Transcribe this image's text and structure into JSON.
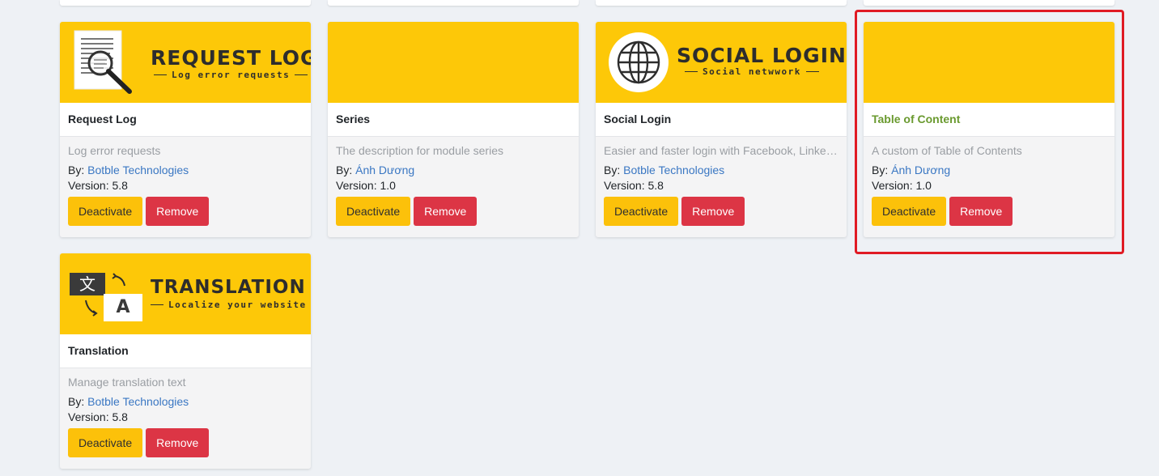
{
  "plugins": [
    {
      "banner": {
        "title": "REQUEST LOG",
        "subtitle": "Log error requests",
        "icon": "document-magnifier-icon"
      },
      "name": "Request Log",
      "description": "Log error requests",
      "by_label": "By:",
      "author": "Botble Technologies",
      "version": "Version: 5.8",
      "deactivate_label": "Deactivate",
      "remove_label": "Remove"
    },
    {
      "banner": {
        "title": "",
        "subtitle": ""
      },
      "name": "Series",
      "description": "The description for module series",
      "by_label": "By:",
      "author": "Ánh Dương",
      "version": "Version: 1.0",
      "deactivate_label": "Deactivate",
      "remove_label": "Remove"
    },
    {
      "banner": {
        "title": "SOCIAL LOGIN",
        "subtitle": "Social netwwork",
        "icon": "globe-icon"
      },
      "name": "Social Login",
      "description": "Easier and faster login with Facebook, LinkedIn, Google, Github",
      "by_label": "By:",
      "author": "Botble Technologies",
      "version": "Version: 5.8",
      "deactivate_label": "Deactivate",
      "remove_label": "Remove"
    },
    {
      "banner": {
        "title": "",
        "subtitle": ""
      },
      "name": "Table of Content",
      "description": "A custom of Table of Contents",
      "by_label": "By:",
      "author": "Ánh Dương",
      "version": "Version: 1.0",
      "deactivate_label": "Deactivate",
      "remove_label": "Remove"
    },
    {
      "banner": {
        "title": "TRANSLATION",
        "subtitle": "Localize your website",
        "icon": "translate-icon",
        "glyph_source": "文",
        "glyph_target": "A"
      },
      "name": "Translation",
      "description": "Manage translation text",
      "by_label": "By:",
      "author": "Botble Technologies",
      "version": "Version: 5.8",
      "deactivate_label": "Deactivate",
      "remove_label": "Remove"
    }
  ],
  "colors": {
    "banner_bg": "#fdc808",
    "deactivate_bg": "#fcc10a",
    "remove_bg": "#dc3545",
    "highlight_border": "#e01b24",
    "highlight_title": "#6a9a2f",
    "link": "#3a77c3"
  }
}
